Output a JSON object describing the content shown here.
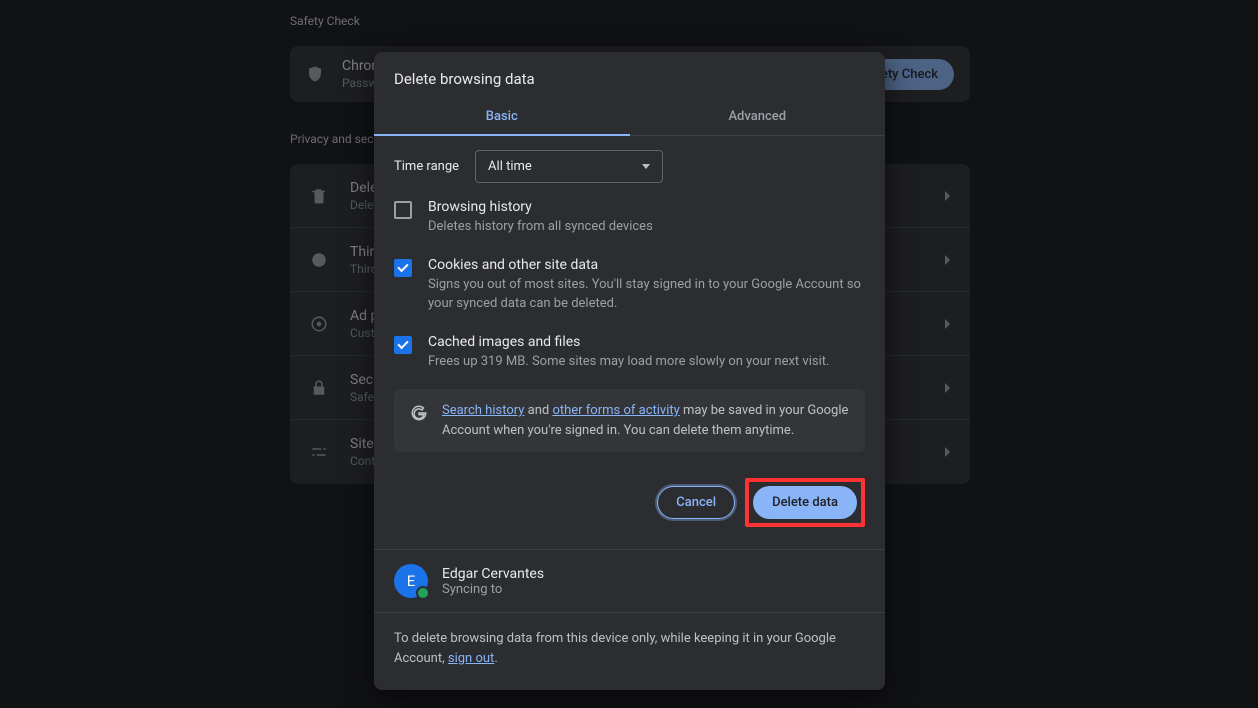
{
  "page": {
    "sections": {
      "safety_title": "Safety Check",
      "privacy_title": "Privacy and security"
    },
    "safety_card": {
      "title": "Chrome found some safety recommendations",
      "sub": "Passwords, extensions and more",
      "button": "Safety Check"
    },
    "rows": {
      "delete": {
        "title": "Delete browsing data",
        "sub": "Delete history, cookies, cache and more"
      },
      "cookies": {
        "title": "Third-party cookies",
        "sub": "Third-party cookies are blocked"
      },
      "ads": {
        "title": "Ad privacy",
        "sub": "Customise the info used for ads"
      },
      "security": {
        "title": "Security",
        "sub": "Safe Browsing (protection from dangerous sites) and other security settings"
      },
      "site": {
        "title": "Site settings",
        "sub": "Controls what information sites can use and show"
      }
    }
  },
  "modal": {
    "title": "Delete browsing data",
    "tabs": {
      "basic": "Basic",
      "advanced": "Advanced"
    },
    "time_range_label": "Time range",
    "time_range_value": "All time",
    "items": {
      "history": {
        "title": "Browsing history",
        "desc": "Deletes history from all synced devices"
      },
      "cookies": {
        "title": "Cookies and other site data",
        "desc": "Signs you out of most sites. You'll stay signed in to your Google Account so your synced data can be deleted."
      },
      "cache": {
        "title": "Cached images and files",
        "desc": "Frees up 319 MB. Some sites may load more slowly on your next visit."
      }
    },
    "info": {
      "link1": "Search history",
      "mid": " and ",
      "link2": "other forms of activity",
      "rest": " may be saved in your Google Account when you're signed in. You can delete them anytime."
    },
    "buttons": {
      "cancel": "Cancel",
      "delete": "Delete data"
    },
    "account": {
      "initial": "E",
      "name": "Edgar Cervantes",
      "status": "Syncing to"
    },
    "footer": {
      "text_before": "To delete browsing data from this device only, while keeping it in your Google Account, ",
      "signout": "sign out",
      "text_after": "."
    }
  }
}
